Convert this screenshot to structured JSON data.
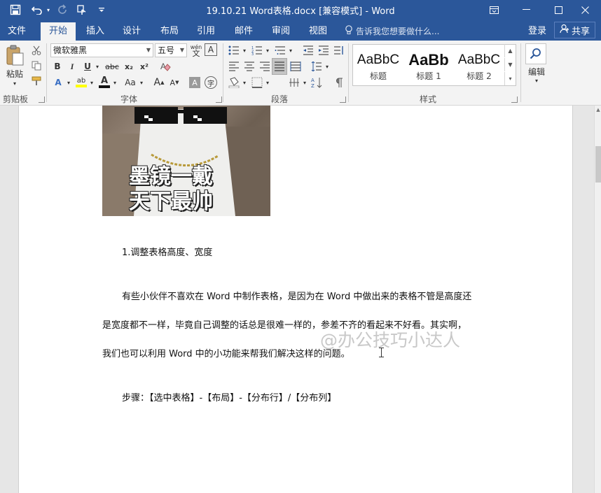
{
  "window": {
    "title": "19.10.21 Word表格.docx [兼容模式] - Word",
    "controls": {
      "ribbon_display": "⧉",
      "minimize": "—",
      "maximize": "☐",
      "close": "✕"
    }
  },
  "quick_access": {
    "save_icon": "save-icon",
    "undo_icon": "undo-icon",
    "redo_icon": "redo-icon",
    "touch_icon": "touch-mode-icon",
    "customize_icon": "customize-icon"
  },
  "tabs": [
    {
      "label": "文件",
      "active": false
    },
    {
      "label": "开始",
      "active": true
    },
    {
      "label": "插入",
      "active": false
    },
    {
      "label": "设计",
      "active": false
    },
    {
      "label": "布局",
      "active": false
    },
    {
      "label": "引用",
      "active": false
    },
    {
      "label": "邮件",
      "active": false
    },
    {
      "label": "审阅",
      "active": false
    },
    {
      "label": "视图",
      "active": false
    }
  ],
  "tell_me": {
    "placeholder": "告诉我您想要做什么..."
  },
  "account": {
    "login": "登录",
    "share": "共享"
  },
  "ribbon": {
    "clipboard": {
      "label": "剪贴板",
      "paste": "粘贴"
    },
    "font": {
      "label": "字体",
      "font_name": "微软雅黑",
      "font_size": "五号",
      "wen": "wén",
      "wen_char": "文",
      "A_box": "A",
      "bold": "B",
      "italic": "I",
      "underline": "U",
      "strike": "abc",
      "sub": "x₂",
      "sup": "x²",
      "text_effect": "A",
      "highlight": "ab",
      "font_color": "A",
      "aa": "Aa",
      "grow": "A",
      "shrink": "A",
      "char_shading": "A",
      "enclose": "字"
    },
    "paragraph": {
      "label": "段落"
    },
    "styles": {
      "label": "样式",
      "items": [
        {
          "sample": "AaBbC",
          "name": "标题",
          "bold": false
        },
        {
          "sample": "AaBb",
          "name": "标题 1",
          "bold": true
        },
        {
          "sample": "AaBbC",
          "name": "标题 2",
          "bold": false
        }
      ]
    },
    "editing": {
      "label": "编辑"
    }
  },
  "document": {
    "meme_text_line1": "墨镜一戴",
    "meme_text_line2": "天下最帅",
    "heading": "1.调整表格高度、宽度",
    "para_line1": "有些小伙伴不喜欢在 Word 中制作表格，是因为在 Word 中做出来的表格不管是高度还",
    "para_line2": "是宽度都不一样，毕竟自己调整的话总是很难一样的，参差不齐的看起来不好看。其实啊，",
    "para_line3": "我们也可以利用 Word 中的小功能来帮我们解决这样的问题。",
    "steps": "步骤：【选中表格】-【布局】-【分布行】/【分布列】",
    "watermark": "@办公技巧小达人"
  },
  "colors": {
    "accent": "#2b579a",
    "ribbon_bg": "#f3f3f3",
    "page_bg": "#ffffff",
    "workspace": "#e6e6e6"
  }
}
